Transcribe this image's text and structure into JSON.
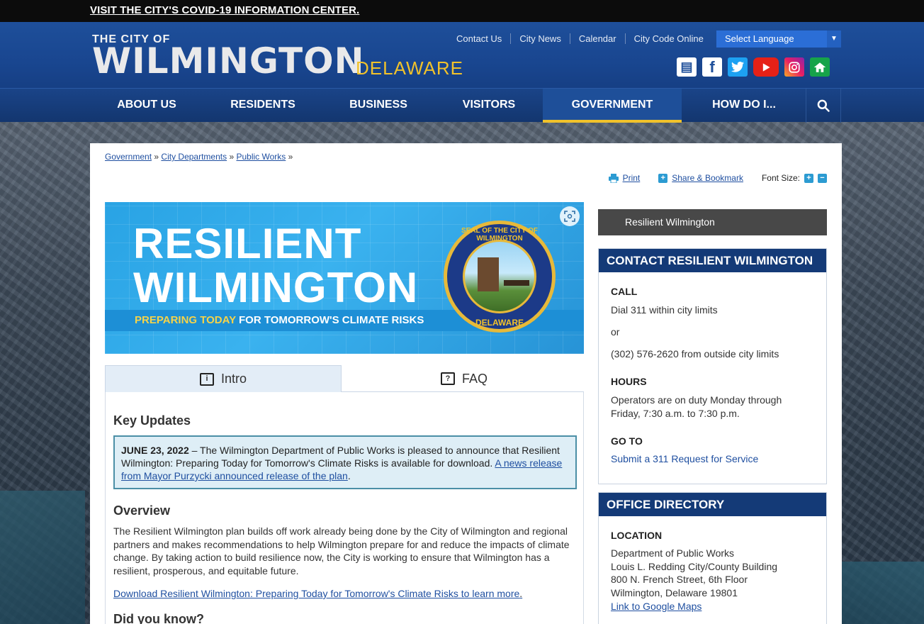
{
  "alert": {
    "text": "VISIT THE CITY'S COVID-19 INFORMATION CENTER."
  },
  "logo": {
    "line1": "THE CITY OF",
    "line2": "WILMINGTON",
    "line3": "DELAWARE"
  },
  "top_links": [
    "Contact Us",
    "City News",
    "Calendar",
    "City Code Online"
  ],
  "language": {
    "label": "Select Language"
  },
  "social": [
    "news-icon",
    "facebook-icon",
    "twitter-icon",
    "youtube-icon",
    "instagram-icon",
    "nextdoor-icon"
  ],
  "nav": {
    "items": [
      "ABOUT US",
      "RESIDENTS",
      "BUSINESS",
      "VISITORS",
      "GOVERNMENT",
      "HOW DO I..."
    ],
    "active": "GOVERNMENT"
  },
  "breadcrumb": {
    "items": [
      "Government",
      "City Departments",
      "Public Works"
    ],
    "sep": "»"
  },
  "tools": {
    "print": "Print",
    "share": "Share & Bookmark",
    "font_size": "Font Size:"
  },
  "banner": {
    "title1": "RESILIENT",
    "title2": "WILMINGTON",
    "sub_a": "PREPARING TODAY",
    "sub_b": "FOR TOMORROW'S CLIMATE RISKS",
    "seal_top": "SEAL OF THE CITY OF WILMINGTON",
    "seal_bottom": "DELAWARE"
  },
  "tabs": [
    "Intro",
    "FAQ"
  ],
  "intro": {
    "key_updates": "Key Updates",
    "update_date": "JUNE 23, 2022",
    "update_text": " – The Wilmington Department of Public Works is pleased to announce that Resilient Wilmington: Preparing Today for Tomorrow's Climate Risks is available for download. ",
    "update_link": "A news release from Mayor Purzycki announced release of the plan",
    "overview": "Overview",
    "overview_text": "The Resilient Wilmington plan builds off work already being done by the City of Wilmington and regional partners and makes recommendations to help Wilmington prepare for and reduce the impacts of climate change. By taking action to build resilience now, the City is working to ensure that Wilmington has a resilient, prosperous, and equitable future.",
    "download_link": "Download Resilient Wilmington: Preparing Today for Tomorrow's Climate Risks to learn more",
    "did_you_know": "Did you know?"
  },
  "sidebar": {
    "selected": "Resilient Wilmington",
    "contact": {
      "title": "CONTACT RESILIENT WILMINGTON",
      "call_label": "CALL",
      "call_1": "Dial 311 within city limits",
      "or": "or",
      "call_2": "(302) 576-2620 from outside city limits",
      "hours_label": "HOURS",
      "hours_1": "Operators are on duty Monday through",
      "hours_2": "Friday, 7:30 a.m. to 7:30 p.m.",
      "goto_label": "GO TO",
      "goto_link": "Submit a 311 Request for Service"
    },
    "directory": {
      "title": "OFFICE DIRECTORY",
      "location_label": "LOCATION",
      "line1": "Department of Public Works",
      "line2": "Louis L. Redding City/County Building",
      "line3": "800 N. French Street, 6th Floor",
      "line4": "Wilmington, Delaware 19801",
      "map_link": "Link to Google Maps"
    }
  }
}
